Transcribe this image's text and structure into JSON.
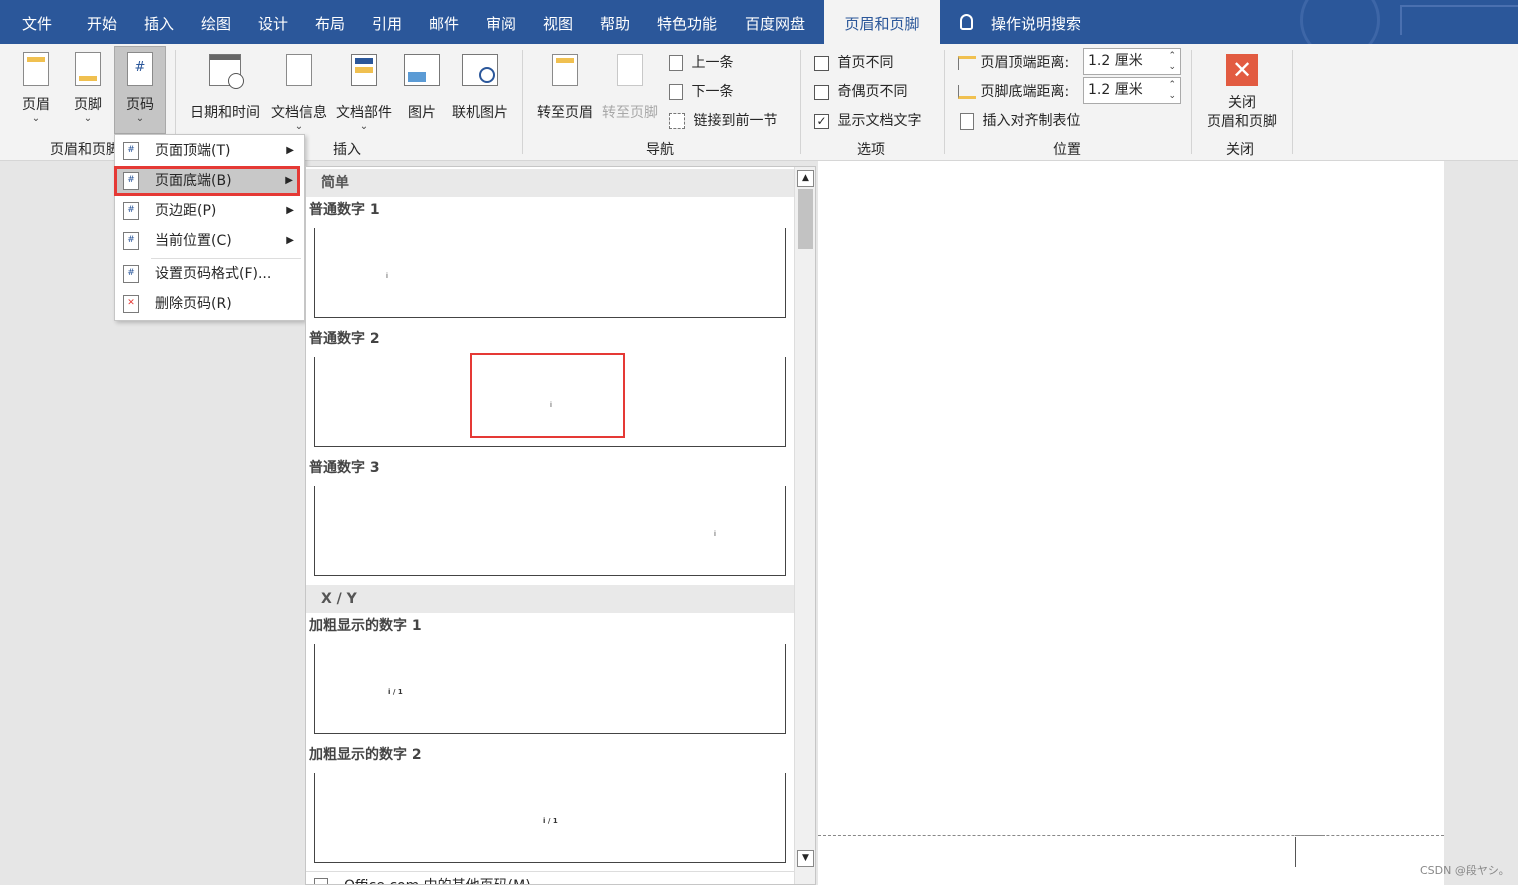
{
  "tabs": [
    "文件",
    "开始",
    "插入",
    "绘图",
    "设计",
    "布局",
    "引用",
    "邮件",
    "审阅",
    "视图",
    "帮助",
    "特色功能",
    "百度网盘",
    "页眉和页脚",
    "操作说明搜索"
  ],
  "ribbon": {
    "header_btn": "页眉",
    "footer_btn": "页脚",
    "pagenum_btn": "页码",
    "datetime_btn": "日期和时间",
    "docinfo_btn": "文档信息",
    "docparts_btn": "文档部件",
    "picture_btn": "图片",
    "online_pic_btn": "联机图片",
    "goto_header_btn": "转至页眉",
    "goto_footer_btn": "转至页脚",
    "prev_btn": "上一条",
    "next_btn": "下一条",
    "link_prev_btn": "链接到前一节",
    "opt_first": "首页不同",
    "opt_oddeven": "奇偶页不同",
    "opt_showtext": "显示文档文字",
    "opt_showtext_checked": "✓",
    "header_dist_label": "页眉顶端距离:",
    "header_dist_value": "1.2 厘米",
    "footer_dist_label": "页脚底端距离:",
    "footer_dist_value": "1.2 厘米",
    "insert_align_tab": "插入对齐制表位",
    "close_btn_line1": "关闭",
    "close_btn_line2": "页眉和页脚",
    "groups": {
      "hf": "页眉和页脚",
      "insert": "插入",
      "nav": "导航",
      "options": "选项",
      "position": "位置",
      "close": "关闭"
    }
  },
  "menu": {
    "items": [
      "页面顶端(T)",
      "页面底端(B)",
      "页边距(P)",
      "当前位置(C)",
      "设置页码格式(F)...",
      "删除页码(R)"
    ]
  },
  "gallery": {
    "section_simple": "简单",
    "section_xy": "X / Y",
    "item1": "普通数字 1",
    "item2": "普通数字 2",
    "item3": "普通数字 3",
    "item4": "加粗显示的数字 1",
    "item5": "加粗显示的数字 2",
    "num": "i",
    "numxy": "i / 1",
    "more": "Office.com 中的其他页码(M)"
  },
  "watermark": "CSDN @段ヤシ。",
  "colors": {
    "accent": "#2b579a",
    "highlight": "#e53935",
    "close_red": "#e25b41"
  }
}
